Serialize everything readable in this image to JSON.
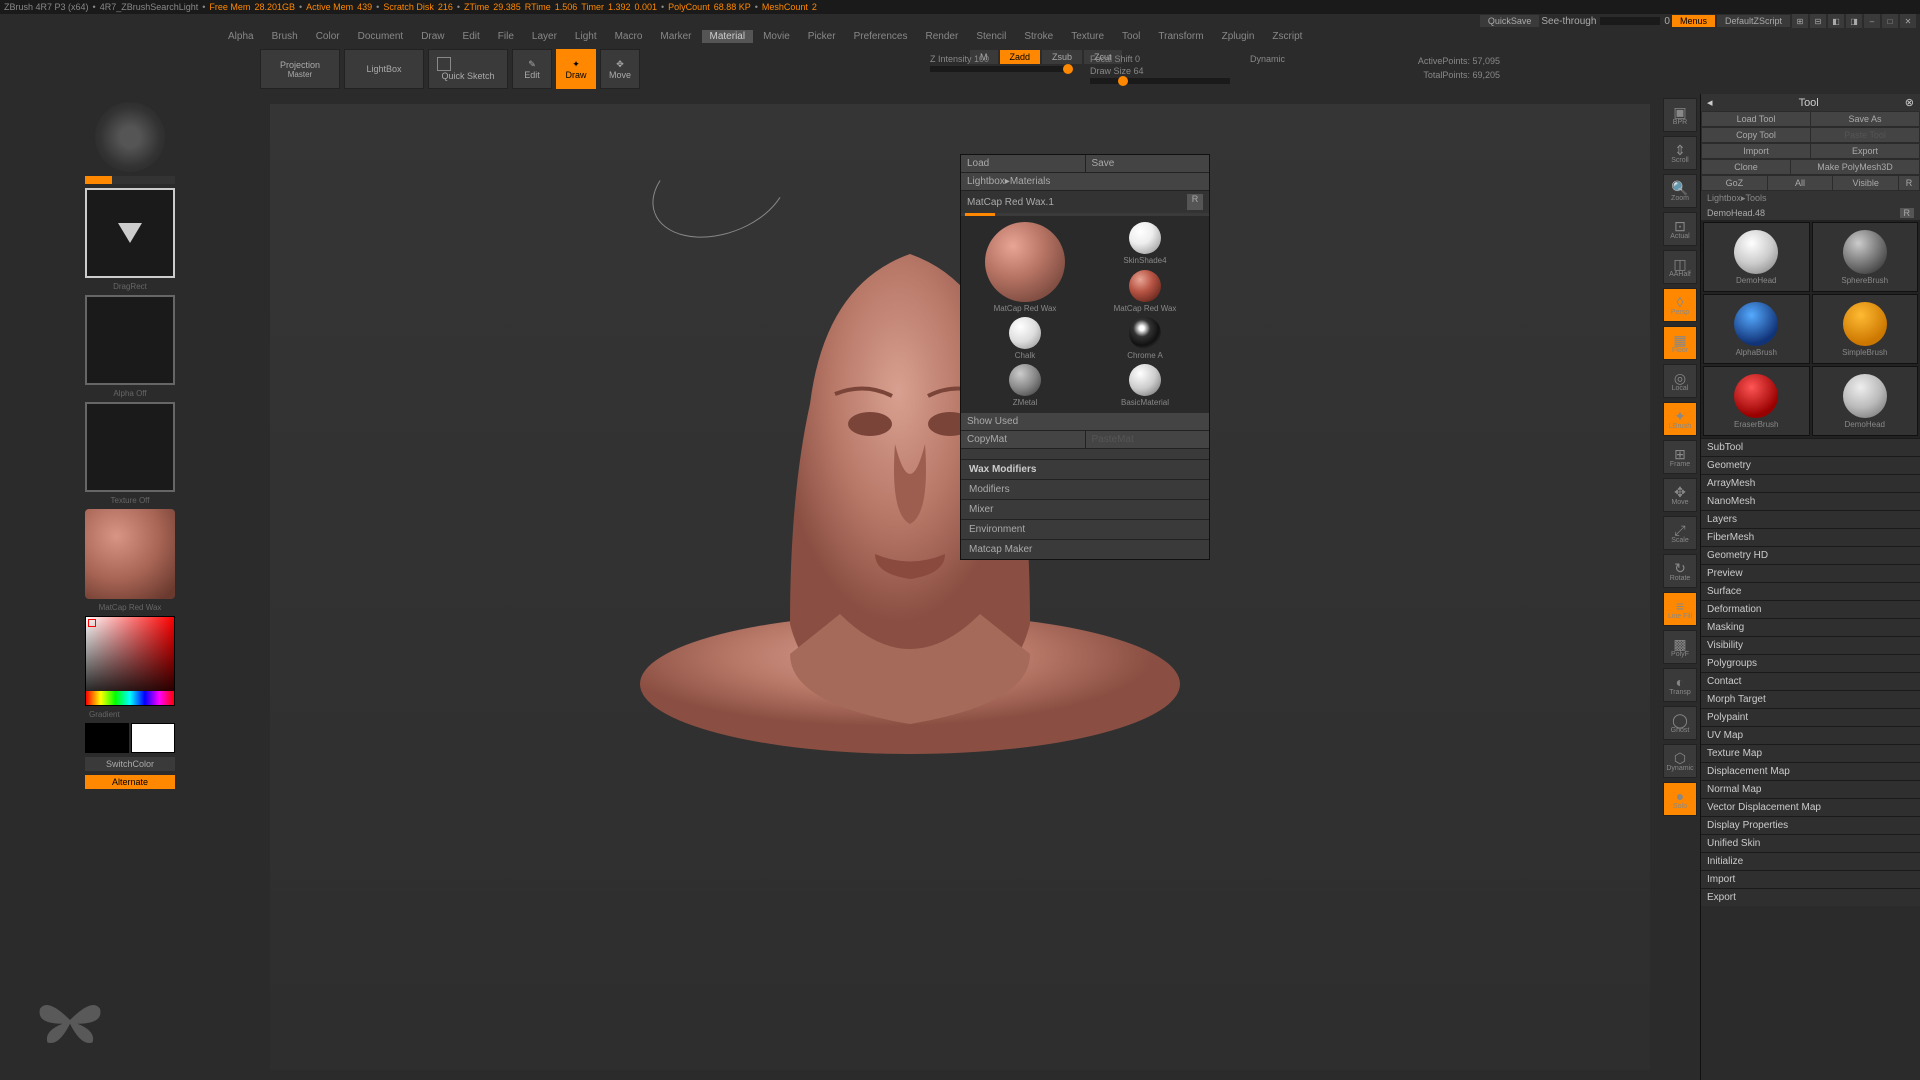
{
  "titlebar": {
    "app": "ZBrush 4R7 P3 (x64)",
    "script": "4R7_ZBrushSearchLight",
    "freemem_label": "Free Mem",
    "freemem": "28.201GB",
    "activemem_label": "Active Mem",
    "activemem": "439",
    "scratch_label": "Scratch Disk",
    "scratch": "216",
    "ztime_label": "ZTime",
    "ztime": "29.385",
    "rtime_label": "RTime",
    "rtime": "1.506",
    "timer_label": "Timer",
    "timer": "1.392",
    "timer2": "0.001",
    "polycount_label": "PolyCount",
    "polycount": "68.88 KP",
    "meshcount_label": "MeshCount",
    "meshcount": "2"
  },
  "topctrl": {
    "quicksave": "QuickSave",
    "seethrough": "See-through",
    "seethrough_val": "0",
    "menus": "Menus",
    "script": "DefaultZScript"
  },
  "menubar": {
    "items": [
      "Alpha",
      "Brush",
      "Color",
      "Document",
      "Draw",
      "Edit",
      "File",
      "Layer",
      "Light",
      "Macro",
      "Marker",
      "Material",
      "Movie",
      "Picker",
      "Preferences",
      "Render",
      "Stencil",
      "Stroke",
      "Texture",
      "Tool",
      "Transform",
      "Zplugin",
      "Zscript"
    ],
    "active": "Material"
  },
  "shelf": {
    "projection": "Projection",
    "master": "Master",
    "lightbox": "LightBox",
    "quicksketch": "Quick Sketch",
    "edit": "Edit",
    "draw": "Draw",
    "move": "Move",
    "zadd": "Zadd",
    "zsub": "Zsub",
    "zcut": "Zcut",
    "mrgb": "M",
    "zintensity_label": "Z Intensity",
    "zintensity": "100",
    "focalshift_label": "Focal Shift",
    "focalshift": "0",
    "drawsize_label": "Draw Size",
    "drawsize": "64",
    "dynamic": "Dynamic",
    "activepoints_label": "ActivePoints:",
    "activepoints": "57,095",
    "totalpoints_label": "TotalPoints:",
    "totalpoints": "69,205"
  },
  "leftbar": {
    "dragRect": "DragRect",
    "alpha_off": "Alpha Off",
    "texture_off": "Texture Off",
    "material": "MatCap Red Wax",
    "gradient": "Gradient",
    "switchcolor": "SwitchColor",
    "alternate": "Alternate"
  },
  "mat_popup": {
    "load": "Load",
    "save": "Save",
    "lightbox_mat": "Lightbox▸Materials",
    "current": "MatCap Red Wax.1",
    "r": "R",
    "show_used": "Show Used",
    "copymat": "CopyMat",
    "pastemat": "PasteMat",
    "materials": [
      {
        "name": "MatCap Red Wax"
      },
      {
        "name": "SkinShade4"
      },
      {
        "name": "MatCap Red Wax"
      },
      {
        "name": "Chalk"
      },
      {
        "name": "Chrome A"
      },
      {
        "name": "ZMetal"
      },
      {
        "name": "BasicMaterial"
      }
    ],
    "sections": [
      "Wax Modifiers",
      "Modifiers",
      "Mixer",
      "Environment",
      "Matcap Maker"
    ]
  },
  "rightquick": {
    "items": [
      "BPR",
      "Scroll",
      "Zoom",
      "Actual",
      "AAHalf",
      "Persp",
      "Floor",
      "Local",
      "LBrush",
      "Frame",
      "Move",
      "Scale",
      "Rotate",
      "Line Fill",
      "PolyF",
      "Transp",
      "Ghost",
      "Dynamic",
      "Solo"
    ]
  },
  "rightpanel": {
    "title": "Tool",
    "loadtool": "Load Tool",
    "saveas": "Save As",
    "copytool": "Copy Tool",
    "pastetool": "Paste Tool",
    "import": "Import",
    "export": "Export",
    "clone": "Clone",
    "makepolymesh": "Make PolyMesh3D",
    "goz": "GoZ",
    "all": "All",
    "visible": "Visible",
    "r": "R",
    "lightbox_tools": "Lightbox▸Tools",
    "active_tool": "DemoHead.48",
    "tools": [
      {
        "name": "DemoHead"
      },
      {
        "name": "SphereBrush"
      },
      {
        "name": "AlphaBrush"
      },
      {
        "name": "SimpleBrush"
      },
      {
        "name": "EraserBrush"
      },
      {
        "name": "DemoHead"
      }
    ],
    "accordion": [
      "SubTool",
      "Geometry",
      "ArrayMesh",
      "NanoMesh",
      "Layers",
      "FiberMesh",
      "Geometry HD",
      "Preview",
      "Surface",
      "Deformation",
      "Masking",
      "Visibility",
      "Polygroups",
      "Contact",
      "Morph Target",
      "Polypaint",
      "UV Map",
      "Texture Map",
      "Displacement Map",
      "Normal Map",
      "Vector Displacement Map",
      "Display Properties",
      "Unified Skin",
      "Initialize",
      "Import",
      "Export"
    ]
  }
}
